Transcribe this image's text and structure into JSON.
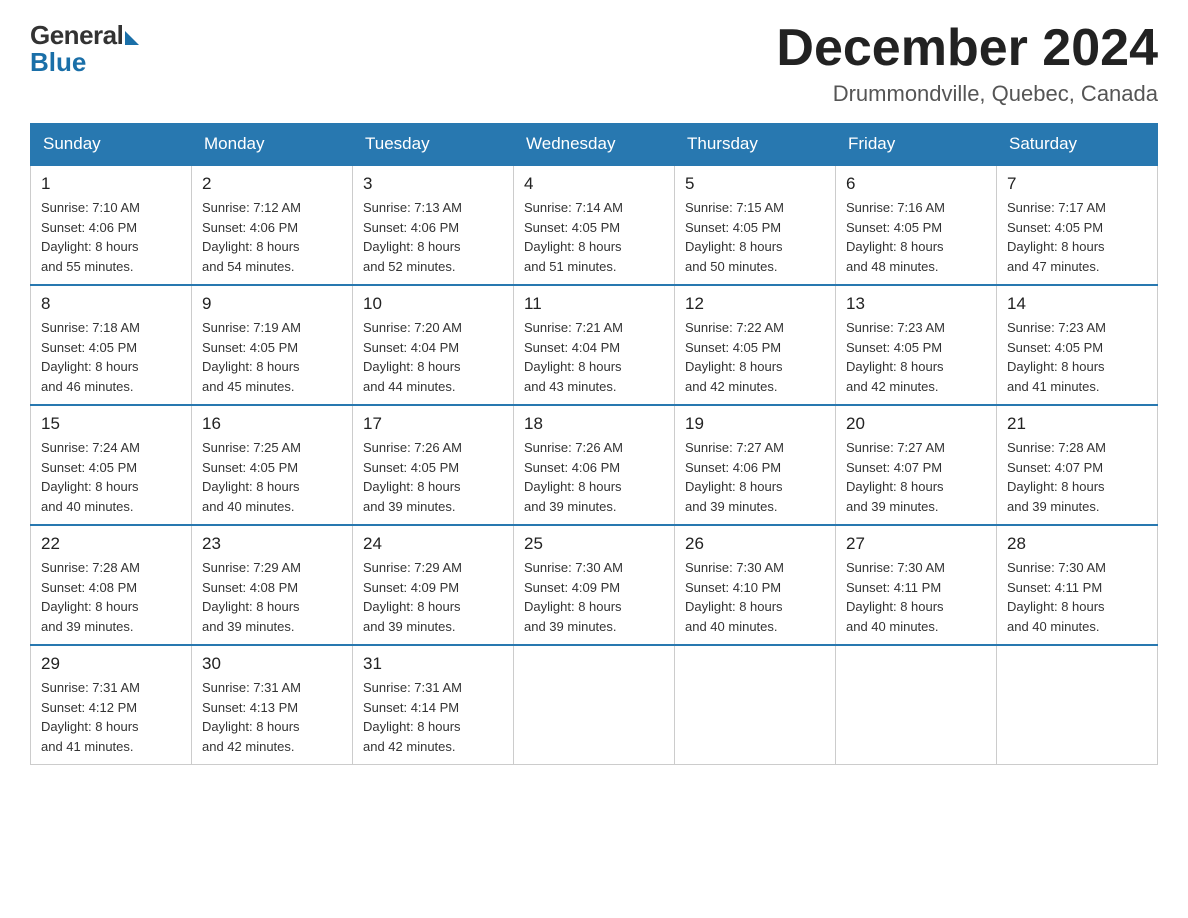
{
  "logo": {
    "general": "General",
    "blue": "Blue"
  },
  "title": "December 2024",
  "location": "Drummondville, Quebec, Canada",
  "headers": [
    "Sunday",
    "Monday",
    "Tuesday",
    "Wednesday",
    "Thursday",
    "Friday",
    "Saturday"
  ],
  "weeks": [
    [
      {
        "day": "1",
        "sunrise": "7:10 AM",
        "sunset": "4:06 PM",
        "daylight": "8 hours and 55 minutes."
      },
      {
        "day": "2",
        "sunrise": "7:12 AM",
        "sunset": "4:06 PM",
        "daylight": "8 hours and 54 minutes."
      },
      {
        "day": "3",
        "sunrise": "7:13 AM",
        "sunset": "4:06 PM",
        "daylight": "8 hours and 52 minutes."
      },
      {
        "day": "4",
        "sunrise": "7:14 AM",
        "sunset": "4:05 PM",
        "daylight": "8 hours and 51 minutes."
      },
      {
        "day": "5",
        "sunrise": "7:15 AM",
        "sunset": "4:05 PM",
        "daylight": "8 hours and 50 minutes."
      },
      {
        "day": "6",
        "sunrise": "7:16 AM",
        "sunset": "4:05 PM",
        "daylight": "8 hours and 48 minutes."
      },
      {
        "day": "7",
        "sunrise": "7:17 AM",
        "sunset": "4:05 PM",
        "daylight": "8 hours and 47 minutes."
      }
    ],
    [
      {
        "day": "8",
        "sunrise": "7:18 AM",
        "sunset": "4:05 PM",
        "daylight": "8 hours and 46 minutes."
      },
      {
        "day": "9",
        "sunrise": "7:19 AM",
        "sunset": "4:05 PM",
        "daylight": "8 hours and 45 minutes."
      },
      {
        "day": "10",
        "sunrise": "7:20 AM",
        "sunset": "4:04 PM",
        "daylight": "8 hours and 44 minutes."
      },
      {
        "day": "11",
        "sunrise": "7:21 AM",
        "sunset": "4:04 PM",
        "daylight": "8 hours and 43 minutes."
      },
      {
        "day": "12",
        "sunrise": "7:22 AM",
        "sunset": "4:05 PM",
        "daylight": "8 hours and 42 minutes."
      },
      {
        "day": "13",
        "sunrise": "7:23 AM",
        "sunset": "4:05 PM",
        "daylight": "8 hours and 42 minutes."
      },
      {
        "day": "14",
        "sunrise": "7:23 AM",
        "sunset": "4:05 PM",
        "daylight": "8 hours and 41 minutes."
      }
    ],
    [
      {
        "day": "15",
        "sunrise": "7:24 AM",
        "sunset": "4:05 PM",
        "daylight": "8 hours and 40 minutes."
      },
      {
        "day": "16",
        "sunrise": "7:25 AM",
        "sunset": "4:05 PM",
        "daylight": "8 hours and 40 minutes."
      },
      {
        "day": "17",
        "sunrise": "7:26 AM",
        "sunset": "4:05 PM",
        "daylight": "8 hours and 39 minutes."
      },
      {
        "day": "18",
        "sunrise": "7:26 AM",
        "sunset": "4:06 PM",
        "daylight": "8 hours and 39 minutes."
      },
      {
        "day": "19",
        "sunrise": "7:27 AM",
        "sunset": "4:06 PM",
        "daylight": "8 hours and 39 minutes."
      },
      {
        "day": "20",
        "sunrise": "7:27 AM",
        "sunset": "4:07 PM",
        "daylight": "8 hours and 39 minutes."
      },
      {
        "day": "21",
        "sunrise": "7:28 AM",
        "sunset": "4:07 PM",
        "daylight": "8 hours and 39 minutes."
      }
    ],
    [
      {
        "day": "22",
        "sunrise": "7:28 AM",
        "sunset": "4:08 PM",
        "daylight": "8 hours and 39 minutes."
      },
      {
        "day": "23",
        "sunrise": "7:29 AM",
        "sunset": "4:08 PM",
        "daylight": "8 hours and 39 minutes."
      },
      {
        "day": "24",
        "sunrise": "7:29 AM",
        "sunset": "4:09 PM",
        "daylight": "8 hours and 39 minutes."
      },
      {
        "day": "25",
        "sunrise": "7:30 AM",
        "sunset": "4:09 PM",
        "daylight": "8 hours and 39 minutes."
      },
      {
        "day": "26",
        "sunrise": "7:30 AM",
        "sunset": "4:10 PM",
        "daylight": "8 hours and 40 minutes."
      },
      {
        "day": "27",
        "sunrise": "7:30 AM",
        "sunset": "4:11 PM",
        "daylight": "8 hours and 40 minutes."
      },
      {
        "day": "28",
        "sunrise": "7:30 AM",
        "sunset": "4:11 PM",
        "daylight": "8 hours and 40 minutes."
      }
    ],
    [
      {
        "day": "29",
        "sunrise": "7:31 AM",
        "sunset": "4:12 PM",
        "daylight": "8 hours and 41 minutes."
      },
      {
        "day": "30",
        "sunrise": "7:31 AM",
        "sunset": "4:13 PM",
        "daylight": "8 hours and 42 minutes."
      },
      {
        "day": "31",
        "sunrise": "7:31 AM",
        "sunset": "4:14 PM",
        "daylight": "8 hours and 42 minutes."
      },
      null,
      null,
      null,
      null
    ]
  ],
  "labels": {
    "sunrise": "Sunrise:",
    "sunset": "Sunset:",
    "daylight": "Daylight:"
  }
}
